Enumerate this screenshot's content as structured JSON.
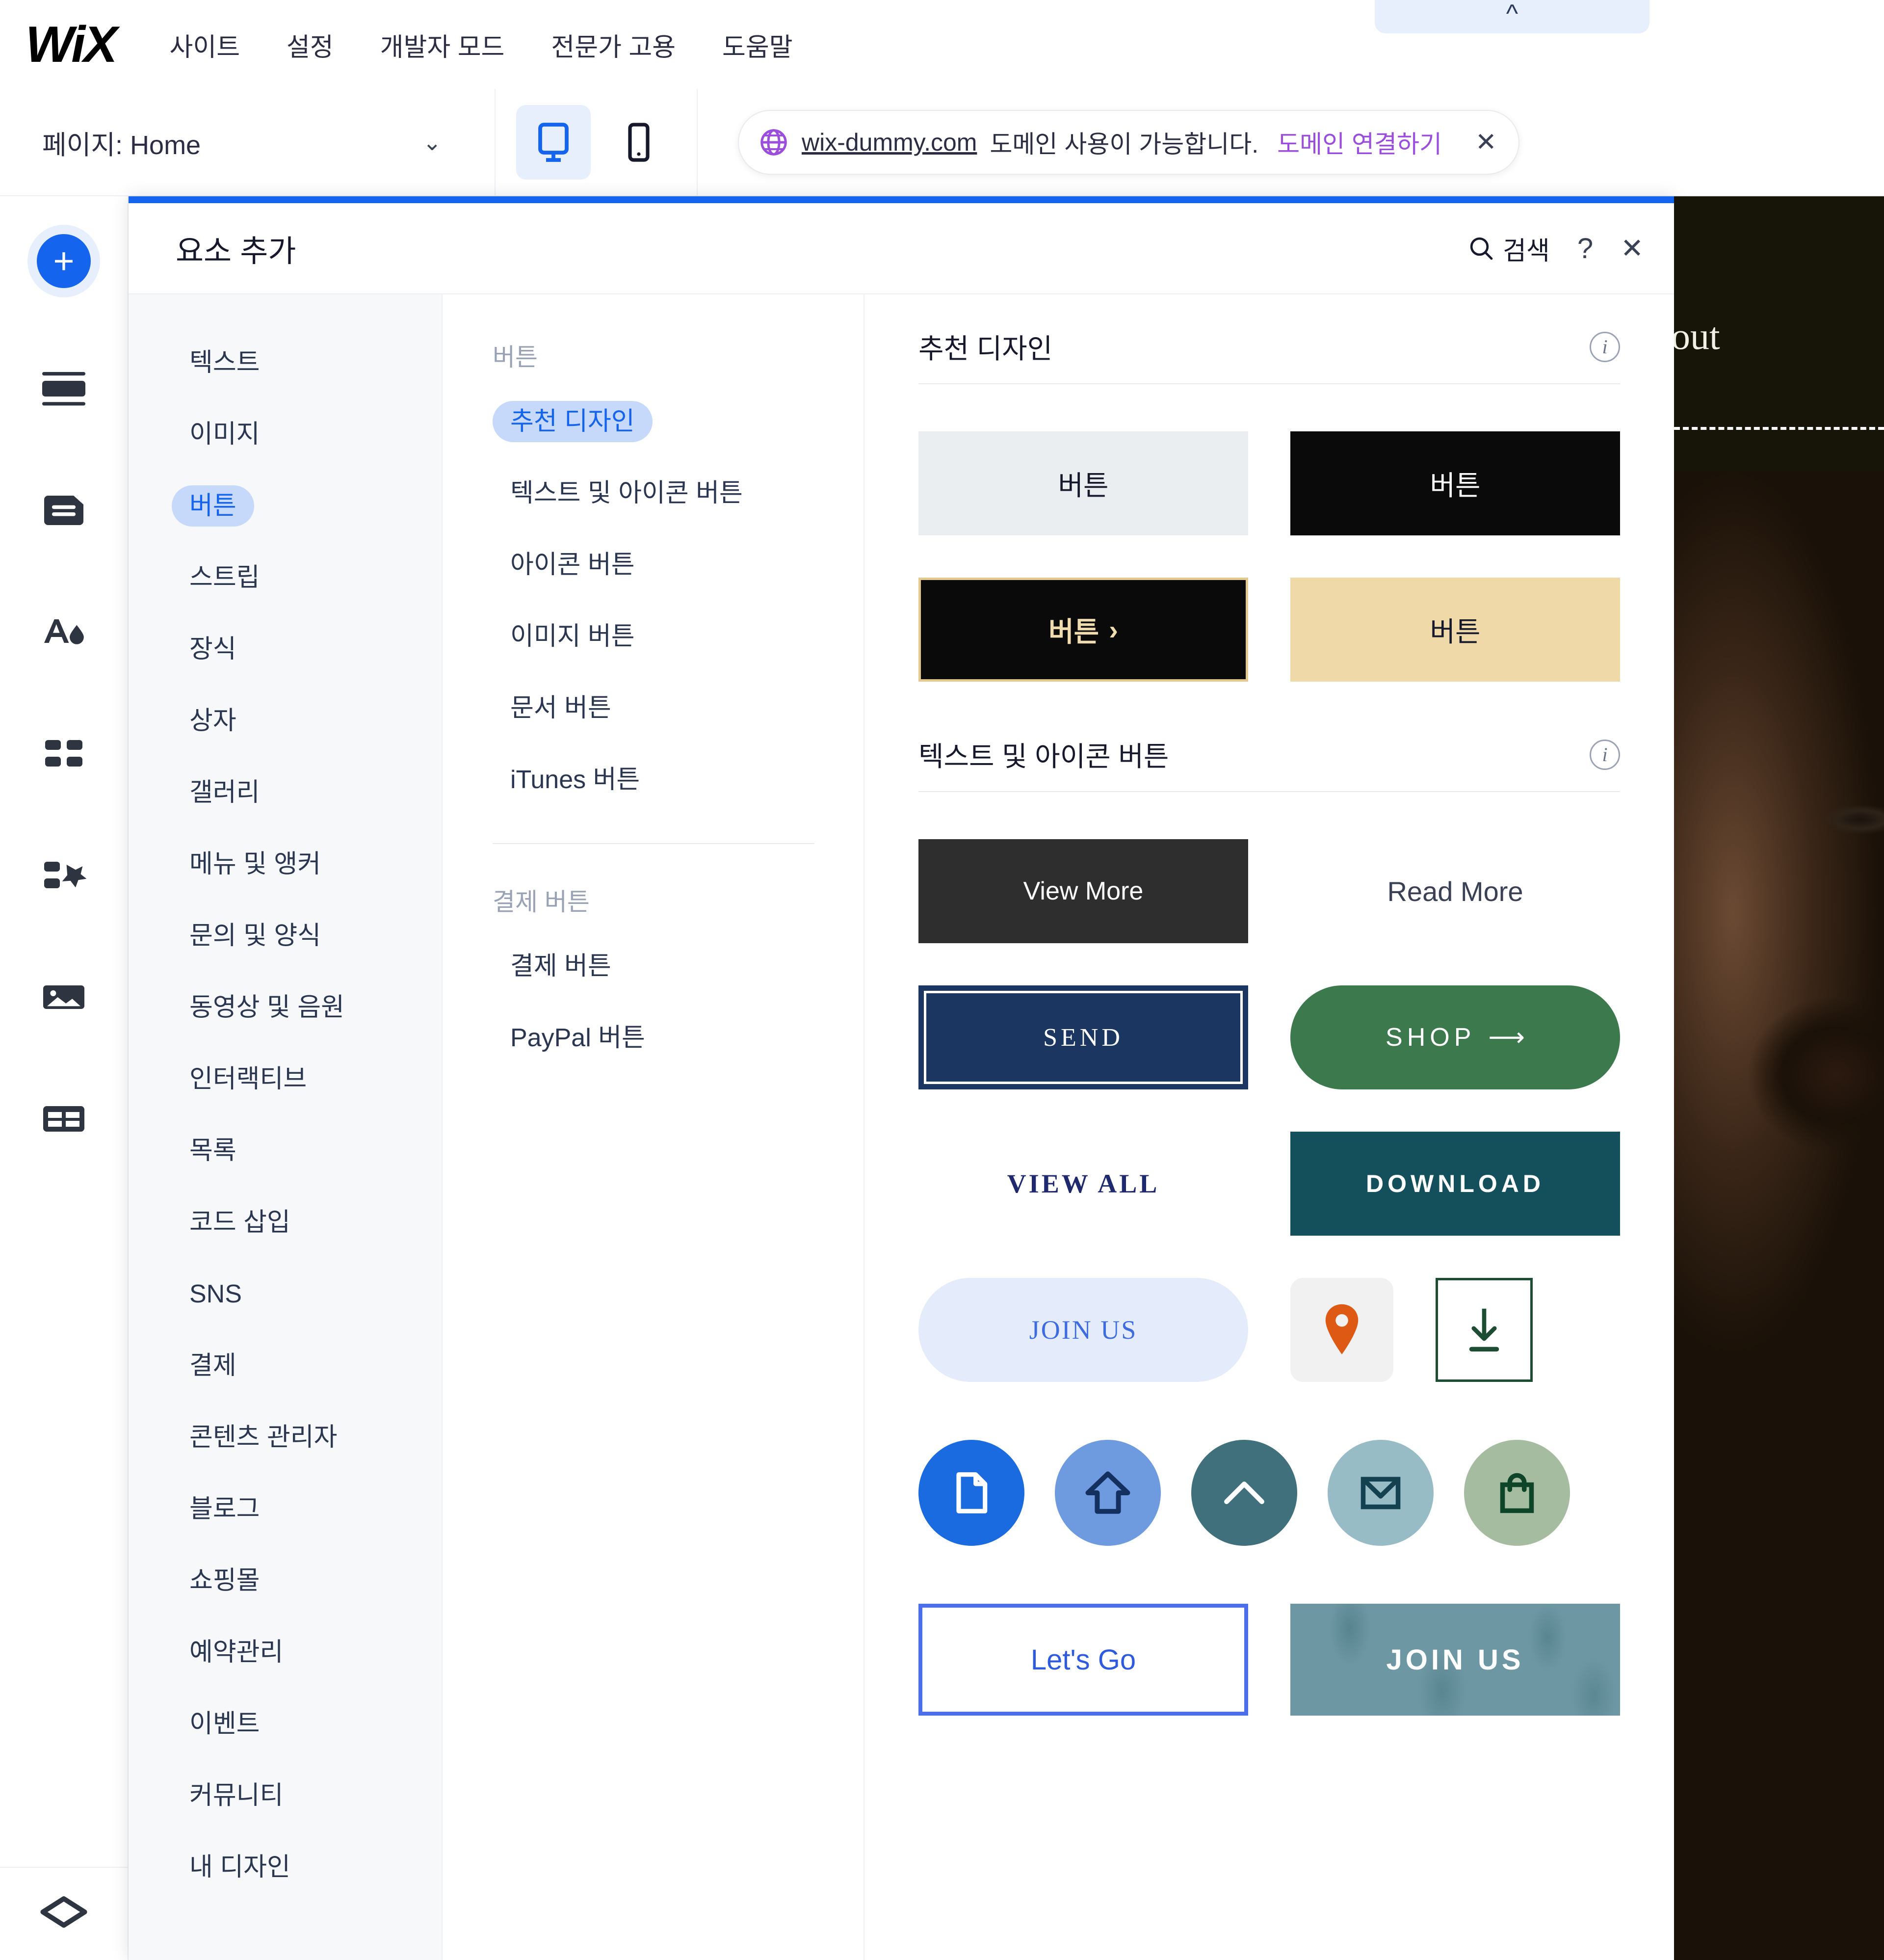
{
  "app": {
    "brand": "WiX",
    "accent_blue": "#1464EE",
    "nav_items": [
      {
        "label": "사이트"
      },
      {
        "label": "설정"
      },
      {
        "label": "개발자 모드"
      },
      {
        "label": "전문가 고용"
      },
      {
        "label": "도움말"
      }
    ]
  },
  "secondbar": {
    "page_label": "페이지: Home",
    "chevron": "⌄",
    "view_desktop_icon": "desktop-icon",
    "view_mobile_icon": "mobile-icon",
    "domain": {
      "url": "wix-dummy.com",
      "message": "도메인 사용이 가능합니다.",
      "cta": "도메인 연결하기",
      "close": "✕",
      "link_color": "#9B4DDC"
    }
  },
  "rail": {
    "items": [
      {
        "name": "add-elements",
        "icon": "plus-icon",
        "active": true
      },
      {
        "name": "sections",
        "icon": "sections-icon",
        "active": false
      },
      {
        "name": "pages",
        "icon": "page-icon",
        "active": false
      },
      {
        "name": "theme",
        "icon": "theme-text-icon",
        "active": false
      },
      {
        "name": "apps",
        "icon": "apps-grid-icon",
        "active": false
      },
      {
        "name": "add-apps",
        "icon": "add-apps-icon",
        "active": false
      },
      {
        "name": "media",
        "icon": "image-icon",
        "active": false
      },
      {
        "name": "layout",
        "icon": "layout-table-icon",
        "active": false
      }
    ],
    "bottom_icon": "hexagon-icon"
  },
  "panel": {
    "title": "요소 추가",
    "search_label": "검색",
    "search_icon": "search-icon",
    "help_label": "?",
    "close_label": "✕",
    "categories": [
      {
        "label": "텍스트",
        "active": false
      },
      {
        "label": "이미지",
        "active": false
      },
      {
        "label": "버튼",
        "active": true
      },
      {
        "label": "스트립",
        "active": false
      },
      {
        "label": "장식",
        "active": false
      },
      {
        "label": "상자",
        "active": false
      },
      {
        "label": "갤러리",
        "active": false
      },
      {
        "label": "메뉴 및 앵커",
        "active": false
      },
      {
        "label": "문의 및 양식",
        "active": false
      },
      {
        "label": "동영상 및 음원",
        "active": false
      },
      {
        "label": "인터랙티브",
        "active": false
      },
      {
        "label": "목록",
        "active": false
      },
      {
        "label": "코드 삽입",
        "active": false
      },
      {
        "label": "SNS",
        "active": false
      },
      {
        "label": "결제",
        "active": false
      },
      {
        "label": "콘텐츠 관리자",
        "active": false
      },
      {
        "label": "블로그",
        "active": false
      },
      {
        "label": "쇼핑몰",
        "active": false
      },
      {
        "label": "예약관리",
        "active": false
      },
      {
        "label": "이벤트",
        "active": false
      },
      {
        "label": "커뮤니티",
        "active": false
      },
      {
        "label": "내 디자인",
        "active": false
      }
    ],
    "subgroups": [
      {
        "title": "버튼",
        "items": [
          {
            "label": "추천 디자인",
            "active": true
          },
          {
            "label": "텍스트 및 아이콘 버튼",
            "active": false
          },
          {
            "label": "아이콘 버튼",
            "active": false
          },
          {
            "label": "이미지 버튼",
            "active": false
          },
          {
            "label": "문서 버튼",
            "active": false
          },
          {
            "label": "iTunes 버튼",
            "active": false
          }
        ]
      },
      {
        "title": "결제 버튼",
        "items": [
          {
            "label": "결제 버튼",
            "active": false
          },
          {
            "label": "PayPal 버튼",
            "active": false
          }
        ]
      }
    ],
    "sections": [
      {
        "title": "추천 디자인",
        "info_icon": "info-icon",
        "swatches": [
          {
            "label": "버튼",
            "style": "light-gray",
            "bg": "#EBEEF0",
            "fg": "#15192B",
            "shape": "rect"
          },
          {
            "label": "버튼",
            "style": "black",
            "bg": "#0A0A0A",
            "fg": "#FFFFFF",
            "shape": "rect"
          },
          {
            "label": "버튼",
            "style": "black-gold-border",
            "bg": "#0A0A0A",
            "fg": "#F0DCAE",
            "shape": "rect",
            "border": "#E3C98F",
            "arrow": "›"
          },
          {
            "label": "버튼",
            "style": "tan",
            "bg": "#EFD9A8",
            "fg": "#15192B",
            "shape": "rect"
          }
        ]
      },
      {
        "title": "텍스트 및 아이콘 버튼",
        "info_icon": "info-icon",
        "swatches": [
          {
            "label": "View More",
            "style": "dark-solid",
            "bg": "#2E2E2E",
            "fg": "#FFFFFF",
            "shape": "rect"
          },
          {
            "label": "Read More",
            "style": "plain-text",
            "bg": "transparent",
            "fg": "#3B4155",
            "shape": "text"
          },
          {
            "label": "SEND",
            "style": "navy-double-border",
            "bg": "#1B3660",
            "fg": "#FFFFFF",
            "shape": "rect",
            "border": "#FFFFFF"
          },
          {
            "label": "SHOP",
            "style": "green-pill",
            "bg": "#3C7A4E",
            "fg": "#FFFFFF",
            "shape": "pill",
            "arrow": "⟶"
          },
          {
            "label": "VIEW ALL",
            "style": "plain-navy",
            "bg": "transparent",
            "fg": "#1F2A6E",
            "shape": "text"
          },
          {
            "label": "DOWNLOAD",
            "style": "teal-solid",
            "bg": "#14505C",
            "fg": "#FFFFFF",
            "shape": "rect"
          },
          {
            "label": "JOIN US",
            "style": "lavender-pill",
            "bg": "#E4EBFB",
            "fg": "#3C6CE0",
            "shape": "pill"
          },
          {
            "label": "",
            "style": "pin-icon-tile",
            "bg": "#F1F1F1",
            "fg": "#DE5A14",
            "shape": "rounded",
            "icon": "location-pin-icon"
          },
          {
            "label": "",
            "style": "download-outline",
            "bg": "#FFFFFF",
            "fg": "#1D4D33",
            "shape": "rect",
            "border": "#1D4D33",
            "icon": "download-arrow-icon"
          }
        ],
        "icon_circles": [
          {
            "icon": "document-icon",
            "bg": "#1A6AE0",
            "fg": "#FFFFFF"
          },
          {
            "icon": "home-arrow-icon",
            "bg": "#6E9AE0",
            "fg": "#14305E"
          },
          {
            "icon": "chevron-up-icon",
            "bg": "#3F707B",
            "fg": "#FFFFFF"
          },
          {
            "icon": "envelope-icon",
            "bg": "#97BCC6",
            "fg": "#14414F"
          },
          {
            "icon": "shopping-bag-icon",
            "bg": "#A6BCA0",
            "fg": "#0E4428"
          }
        ],
        "bottom_swatches": [
          {
            "label": "Let's Go",
            "style": "blue-outline",
            "bg": "#FFFFFF",
            "fg": "#2E5BDE",
            "border": "#4C6EE8"
          },
          {
            "label": "JOIN US",
            "style": "teal-floral",
            "bg": "#6D98A3",
            "fg": "#FFFFFF"
          }
        ]
      }
    ]
  },
  "canvas": {
    "cropped_heading": "out",
    "divider": "dashed-line"
  }
}
